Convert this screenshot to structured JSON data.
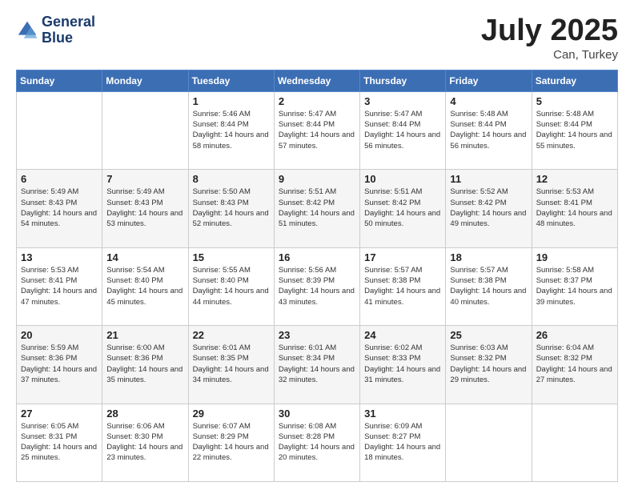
{
  "header": {
    "logo_line1": "General",
    "logo_line2": "Blue",
    "month": "July 2025",
    "location": "Can, Turkey"
  },
  "weekdays": [
    "Sunday",
    "Monday",
    "Tuesday",
    "Wednesday",
    "Thursday",
    "Friday",
    "Saturday"
  ],
  "weeks": [
    [
      {
        "day": "",
        "sunrise": "",
        "sunset": "",
        "daylight": ""
      },
      {
        "day": "",
        "sunrise": "",
        "sunset": "",
        "daylight": ""
      },
      {
        "day": "1",
        "sunrise": "Sunrise: 5:46 AM",
        "sunset": "Sunset: 8:44 PM",
        "daylight": "Daylight: 14 hours and 58 minutes."
      },
      {
        "day": "2",
        "sunrise": "Sunrise: 5:47 AM",
        "sunset": "Sunset: 8:44 PM",
        "daylight": "Daylight: 14 hours and 57 minutes."
      },
      {
        "day": "3",
        "sunrise": "Sunrise: 5:47 AM",
        "sunset": "Sunset: 8:44 PM",
        "daylight": "Daylight: 14 hours and 56 minutes."
      },
      {
        "day": "4",
        "sunrise": "Sunrise: 5:48 AM",
        "sunset": "Sunset: 8:44 PM",
        "daylight": "Daylight: 14 hours and 56 minutes."
      },
      {
        "day": "5",
        "sunrise": "Sunrise: 5:48 AM",
        "sunset": "Sunset: 8:44 PM",
        "daylight": "Daylight: 14 hours and 55 minutes."
      }
    ],
    [
      {
        "day": "6",
        "sunrise": "Sunrise: 5:49 AM",
        "sunset": "Sunset: 8:43 PM",
        "daylight": "Daylight: 14 hours and 54 minutes."
      },
      {
        "day": "7",
        "sunrise": "Sunrise: 5:49 AM",
        "sunset": "Sunset: 8:43 PM",
        "daylight": "Daylight: 14 hours and 53 minutes."
      },
      {
        "day": "8",
        "sunrise": "Sunrise: 5:50 AM",
        "sunset": "Sunset: 8:43 PM",
        "daylight": "Daylight: 14 hours and 52 minutes."
      },
      {
        "day": "9",
        "sunrise": "Sunrise: 5:51 AM",
        "sunset": "Sunset: 8:42 PM",
        "daylight": "Daylight: 14 hours and 51 minutes."
      },
      {
        "day": "10",
        "sunrise": "Sunrise: 5:51 AM",
        "sunset": "Sunset: 8:42 PM",
        "daylight": "Daylight: 14 hours and 50 minutes."
      },
      {
        "day": "11",
        "sunrise": "Sunrise: 5:52 AM",
        "sunset": "Sunset: 8:42 PM",
        "daylight": "Daylight: 14 hours and 49 minutes."
      },
      {
        "day": "12",
        "sunrise": "Sunrise: 5:53 AM",
        "sunset": "Sunset: 8:41 PM",
        "daylight": "Daylight: 14 hours and 48 minutes."
      }
    ],
    [
      {
        "day": "13",
        "sunrise": "Sunrise: 5:53 AM",
        "sunset": "Sunset: 8:41 PM",
        "daylight": "Daylight: 14 hours and 47 minutes."
      },
      {
        "day": "14",
        "sunrise": "Sunrise: 5:54 AM",
        "sunset": "Sunset: 8:40 PM",
        "daylight": "Daylight: 14 hours and 45 minutes."
      },
      {
        "day": "15",
        "sunrise": "Sunrise: 5:55 AM",
        "sunset": "Sunset: 8:40 PM",
        "daylight": "Daylight: 14 hours and 44 minutes."
      },
      {
        "day": "16",
        "sunrise": "Sunrise: 5:56 AM",
        "sunset": "Sunset: 8:39 PM",
        "daylight": "Daylight: 14 hours and 43 minutes."
      },
      {
        "day": "17",
        "sunrise": "Sunrise: 5:57 AM",
        "sunset": "Sunset: 8:38 PM",
        "daylight": "Daylight: 14 hours and 41 minutes."
      },
      {
        "day": "18",
        "sunrise": "Sunrise: 5:57 AM",
        "sunset": "Sunset: 8:38 PM",
        "daylight": "Daylight: 14 hours and 40 minutes."
      },
      {
        "day": "19",
        "sunrise": "Sunrise: 5:58 AM",
        "sunset": "Sunset: 8:37 PM",
        "daylight": "Daylight: 14 hours and 39 minutes."
      }
    ],
    [
      {
        "day": "20",
        "sunrise": "Sunrise: 5:59 AM",
        "sunset": "Sunset: 8:36 PM",
        "daylight": "Daylight: 14 hours and 37 minutes."
      },
      {
        "day": "21",
        "sunrise": "Sunrise: 6:00 AM",
        "sunset": "Sunset: 8:36 PM",
        "daylight": "Daylight: 14 hours and 35 minutes."
      },
      {
        "day": "22",
        "sunrise": "Sunrise: 6:01 AM",
        "sunset": "Sunset: 8:35 PM",
        "daylight": "Daylight: 14 hours and 34 minutes."
      },
      {
        "day": "23",
        "sunrise": "Sunrise: 6:01 AM",
        "sunset": "Sunset: 8:34 PM",
        "daylight": "Daylight: 14 hours and 32 minutes."
      },
      {
        "day": "24",
        "sunrise": "Sunrise: 6:02 AM",
        "sunset": "Sunset: 8:33 PM",
        "daylight": "Daylight: 14 hours and 31 minutes."
      },
      {
        "day": "25",
        "sunrise": "Sunrise: 6:03 AM",
        "sunset": "Sunset: 8:32 PM",
        "daylight": "Daylight: 14 hours and 29 minutes."
      },
      {
        "day": "26",
        "sunrise": "Sunrise: 6:04 AM",
        "sunset": "Sunset: 8:32 PM",
        "daylight": "Daylight: 14 hours and 27 minutes."
      }
    ],
    [
      {
        "day": "27",
        "sunrise": "Sunrise: 6:05 AM",
        "sunset": "Sunset: 8:31 PM",
        "daylight": "Daylight: 14 hours and 25 minutes."
      },
      {
        "day": "28",
        "sunrise": "Sunrise: 6:06 AM",
        "sunset": "Sunset: 8:30 PM",
        "daylight": "Daylight: 14 hours and 23 minutes."
      },
      {
        "day": "29",
        "sunrise": "Sunrise: 6:07 AM",
        "sunset": "Sunset: 8:29 PM",
        "daylight": "Daylight: 14 hours and 22 minutes."
      },
      {
        "day": "30",
        "sunrise": "Sunrise: 6:08 AM",
        "sunset": "Sunset: 8:28 PM",
        "daylight": "Daylight: 14 hours and 20 minutes."
      },
      {
        "day": "31",
        "sunrise": "Sunrise: 6:09 AM",
        "sunset": "Sunset: 8:27 PM",
        "daylight": "Daylight: 14 hours and 18 minutes."
      },
      {
        "day": "",
        "sunrise": "",
        "sunset": "",
        "daylight": ""
      },
      {
        "day": "",
        "sunrise": "",
        "sunset": "",
        "daylight": ""
      }
    ]
  ]
}
